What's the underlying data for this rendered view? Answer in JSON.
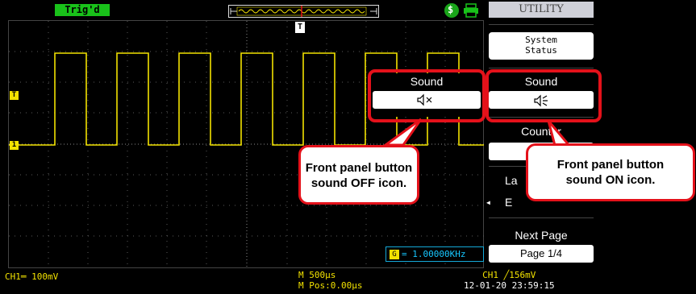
{
  "status": {
    "trigger_state": "Trig'd"
  },
  "menu": {
    "title": "UTILITY",
    "system_status_line1": "System",
    "system_status_line2": "Status",
    "sound_label": "Sound",
    "counter_label": "Counter",
    "language_label": "La",
    "language_value": "E",
    "next_page_label": "Next Page",
    "page_value": "Page 1/4"
  },
  "overlay": {
    "sound_label": "Sound",
    "sound_off_icon": "speaker-muted-icon",
    "sound_on_icon": "speaker-on-icon"
  },
  "callouts": {
    "off_line1": "Front panel button",
    "off_line2": "sound OFF icon.",
    "on_line1": "Front panel button",
    "on_line2": "sound ON icon."
  },
  "readouts": {
    "frequency": "= 1.00000KHz",
    "frequency_icon": "G",
    "channel": "CH1═ 100mV",
    "timebase": "M 500μs",
    "position": "M Pos:0.00μs",
    "trigger": "CH1 ╱156mV",
    "datetime": "12-01-20 23:59:15"
  },
  "markers": {
    "trigger_pos": "T",
    "trigger_level": "T",
    "channel1": "1"
  },
  "colors": {
    "trace": "#f2e200",
    "highlight": "#e4111a",
    "trig_badge": "#19c21a",
    "readout": "#17c7ff"
  }
}
